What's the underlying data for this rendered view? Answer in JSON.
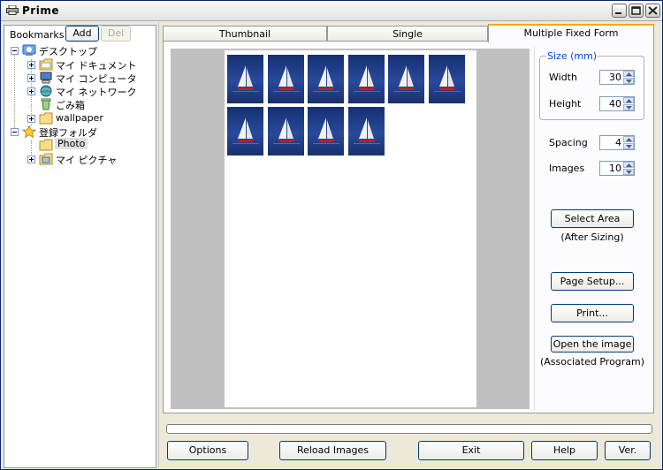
{
  "window": {
    "title": "Prime"
  },
  "bookmarks": {
    "label": "Bookmarks",
    "add_label": "Add",
    "del_label": "Del"
  },
  "tree": [
    {
      "label": "デスクトップ",
      "icon": "desktop-icon"
    },
    {
      "label": "マイ ドキュメント",
      "icon": "folder-icon"
    },
    {
      "label": "マイ コンピュータ",
      "icon": "computer-icon"
    },
    {
      "label": "マイ ネットワーク",
      "icon": "network-icon"
    },
    {
      "label": "ごみ箱",
      "icon": "recycle-bin-icon"
    },
    {
      "label": "wallpaper",
      "icon": "folder-icon"
    },
    {
      "label": "登録フォルダ",
      "icon": "star-icon"
    },
    {
      "label": "Photo",
      "icon": "folder-icon",
      "selected": true
    },
    {
      "label": "マイ ピクチャ",
      "icon": "pictures-folder-icon"
    }
  ],
  "tabs": [
    {
      "label": "Thumbnail",
      "active": false
    },
    {
      "label": "Single",
      "active": false
    },
    {
      "label": "Multiple Fixed Form",
      "active": true
    }
  ],
  "settings": {
    "size_title": "Size (mm)",
    "width_label": "Width",
    "width_value": "30",
    "height_label": "Height",
    "height_value": "40",
    "spacing_label": "Spacing",
    "spacing_value": "4",
    "images_label": "Images",
    "images_value": "10",
    "select_area_label": "Select Area",
    "after_sizing_label": "(After Sizing)",
    "page_setup_label": "Page Setup...",
    "print_label": "Print...",
    "open_image_label": "Open the image",
    "associated_program_label": "(Associated Program)"
  },
  "preview": {
    "image_count": 10
  },
  "bottom": {
    "options_label": "Options",
    "reload_label": "Reload Images",
    "exit_label": "Exit",
    "help_label": "Help",
    "ver_label": "Ver."
  },
  "colors": {
    "accent_tab": "#f4a624",
    "group_title": "#0046d5",
    "selection": "#e0e0e0"
  }
}
